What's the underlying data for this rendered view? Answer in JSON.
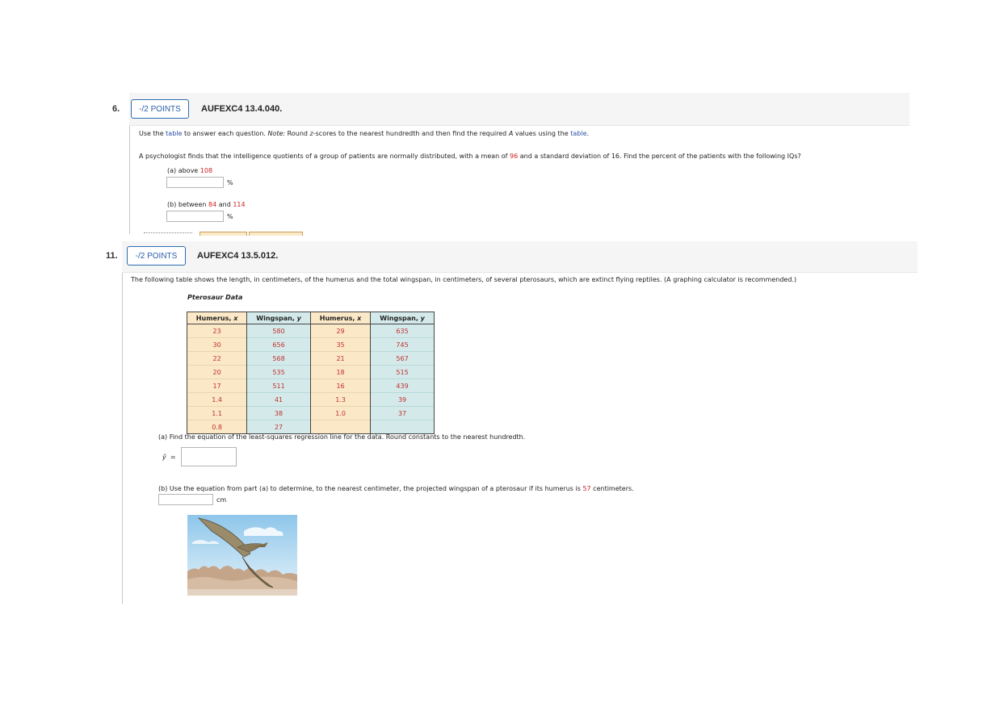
{
  "q6": {
    "number": "6.",
    "points_label": "-/2 POINTS",
    "id": "AUFEXC4 13.4.040.",
    "instr_pre": "Use the ",
    "instr_link": "table",
    "instr_mid1": " to answer each question. ",
    "instr_note": "Note:",
    "instr_mid2": " Round ",
    "instr_z": "z",
    "instr_mid3": "-scores to the nearest hundredth and then find the required ",
    "instr_A": "A",
    "instr_mid4": " values using the ",
    "instr_link2": "table",
    "instr_end": ".",
    "problem_pre": "A psychologist finds that the intelligence quotients of a group of patients are normally distributed, with a mean of ",
    "mean": "96",
    "problem_mid": " and a standard deviation of 16. Find the percent of the patients with the following IQs?",
    "part_a_pre": "(a) above ",
    "part_a_val": "108",
    "part_b_pre": "(b) between ",
    "part_b_v1": "84",
    "part_b_and": " and ",
    "part_b_v2": "114",
    "unit": "%"
  },
  "q11": {
    "number": "11.",
    "points_label": "-/2 POINTS",
    "id": "AUFEXC4 13.5.012.",
    "intro": "The following table shows the length, in centimeters, of the humerus and the total wingspan, in centimeters, of several pterosaurs, which are extinct flying reptiles. (A graphing calculator is recommended.)",
    "table_title": "Pterosaur Data",
    "headers": {
      "h1": "Humerus, ",
      "h1v": "x",
      "w1": "Wingspan, ",
      "w1v": "y",
      "h2": "Humerus, ",
      "h2v": "x",
      "w2": "Wingspan, ",
      "w2v": "y"
    },
    "rows": [
      [
        "23",
        "580",
        "29",
        "635"
      ],
      [
        "30",
        "656",
        "35",
        "745"
      ],
      [
        "22",
        "568",
        "21",
        "567"
      ],
      [
        "20",
        "535",
        "18",
        "515"
      ],
      [
        "17",
        "511",
        "16",
        "439"
      ],
      [
        "1.4",
        "41",
        "1.3",
        "39"
      ],
      [
        "1.1",
        "38",
        "1.0",
        "37"
      ],
      [
        "0.8",
        "27",
        "",
        ""
      ]
    ],
    "part_a": "(a) Find the equation of the least-squares regression line for the data. Round constants to the nearest hundredth.",
    "yhat": "ŷ",
    "equals": "=",
    "part_b_pre": "(b) Use the equation from part (a) to determine, to the nearest centimeter, the projected wingspan of a pterosaur if its humerus is ",
    "part_b_val": "57",
    "part_b_end": " centimeters.",
    "unit": "cm"
  }
}
